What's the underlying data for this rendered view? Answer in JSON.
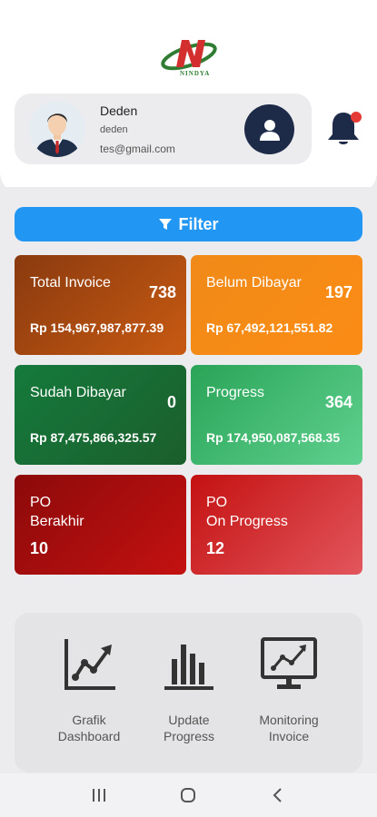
{
  "brand": {
    "logo_text": "NINDYA",
    "accent": "#2196f3"
  },
  "profile": {
    "name": "Deden",
    "username": "deden",
    "email": "tes@gmail.com"
  },
  "filter": {
    "label": "Filter",
    "icon": "filter-icon"
  },
  "tiles": {
    "total_invoice": {
      "label": "Total Invoice",
      "count": "738",
      "amount": "Rp 154,967,987,877.39",
      "color": "#a44711"
    },
    "belum_dibayar": {
      "label": "Belum Dibayar",
      "count": "197",
      "amount": "Rp 67,492,121,551.82",
      "color": "#f5881a"
    },
    "sudah_dibayar": {
      "label": "Sudah Dibayar",
      "count": "0",
      "amount": "Rp 87,475,866,325.57",
      "color": "#166e34"
    },
    "progress": {
      "label": "Progress",
      "count": "364",
      "amount": "Rp 174,950,087,568.35",
      "color": "#3dba6e"
    },
    "po_berakhir": {
      "label_line1": "PO",
      "label_line2": "Berakhir",
      "value": "10",
      "color": "#a30e0e"
    },
    "po_on_progress": {
      "label_line1": "PO",
      "label_line2": "On Progress",
      "value": "12",
      "color": "#d63a40"
    }
  },
  "menu": [
    {
      "label_line1": "Grafik",
      "label_line2": "Dashboard",
      "icon": "line-chart-icon"
    },
    {
      "label_line1": "Update",
      "label_line2": "Progress",
      "icon": "bar-chart-icon"
    },
    {
      "label_line1": "Monitoring",
      "label_line2": "Invoice",
      "icon": "monitor-chart-icon"
    }
  ],
  "nav": {
    "recent": "recent-apps-icon",
    "home": "home-icon",
    "back": "back-icon"
  }
}
